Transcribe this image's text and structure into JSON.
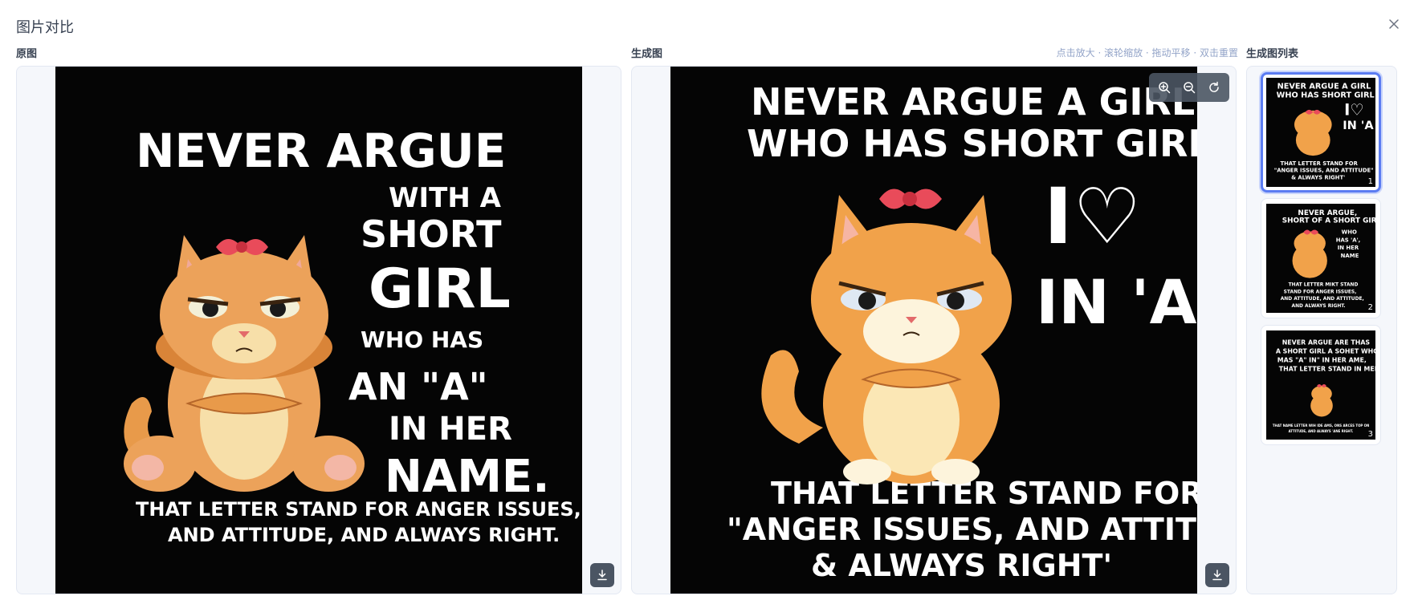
{
  "dialog": {
    "title": "图片对比"
  },
  "original": {
    "label": "原图",
    "poster_lines": [
      "NEVER ARGUE",
      "WITH A",
      "SHORT",
      "GIRL",
      "WHO HAS",
      "AN \"A\"",
      "IN HER",
      "NAME."
    ],
    "poster_footer": [
      "THAT LETTER STAND FOR ANGER ISSUES,",
      "AND ATTITUDE, AND ALWAYS RIGHT."
    ]
  },
  "generated": {
    "label": "生成图",
    "hint": "点击放大 · 滚轮缩放 · 拖动平移 · 双击重置",
    "poster_lines": [
      "NEVER ARGUE A GIRL",
      "WHO HAS SHORT GIRL"
    ],
    "poster_big": "I♡",
    "poster_big2": "IN 'A",
    "poster_footer": [
      "THAT LETTER STAND FOR",
      "\"ANGER ISSUES, AND ATTITUDE\"",
      "& ALWAYS RIGHT'"
    ]
  },
  "list": {
    "label": "生成图列表",
    "thumbs": [
      {
        "num": "1",
        "lines": [
          "NEVER ARGUE A GIRL",
          "WHO HAS SHORT GIRL"
        ],
        "big": "I♡",
        "big2": "IN 'A",
        "footer": [
          "THAT LETTER STAND FOR",
          "\"ANGER ISSUES, AND ATTITUDE\"",
          "& ALWAYS RIGHT'"
        ]
      },
      {
        "num": "2",
        "lines": [
          "NEVER ARGUE,",
          "SHORT OF A SHORT GIRL"
        ],
        "side": [
          "WHO",
          "HAS 'A',",
          "IN HER",
          "NAME"
        ],
        "footer": [
          "THAT LETTER MIKT STAND",
          "STAND FOR ANGER ISSUES,",
          "AND ATTITUDE, AND ATTITUDE,",
          "AND ALWAYS RIGHT."
        ]
      },
      {
        "num": "3",
        "lines": [
          "NEVER ARGUE ARE THAS",
          "A SHORT GIRL A SOHET WHO",
          "MAS \"A\" IN\" IN HER AME,",
          "THAT LETTER STAND IN MER."
        ],
        "footer": [
          "THAT NAME LETTER WIH IDE AMS, ONS ARCES TOP ON",
          "ATTITUDE, AND ALWAYS 'ANE RIGHT."
        ]
      }
    ]
  },
  "icons": {
    "close": "close-icon",
    "download": "download-icon",
    "zoom_in": "zoom-in-icon",
    "zoom_out": "zoom-out-icon",
    "reset": "reset-icon"
  }
}
